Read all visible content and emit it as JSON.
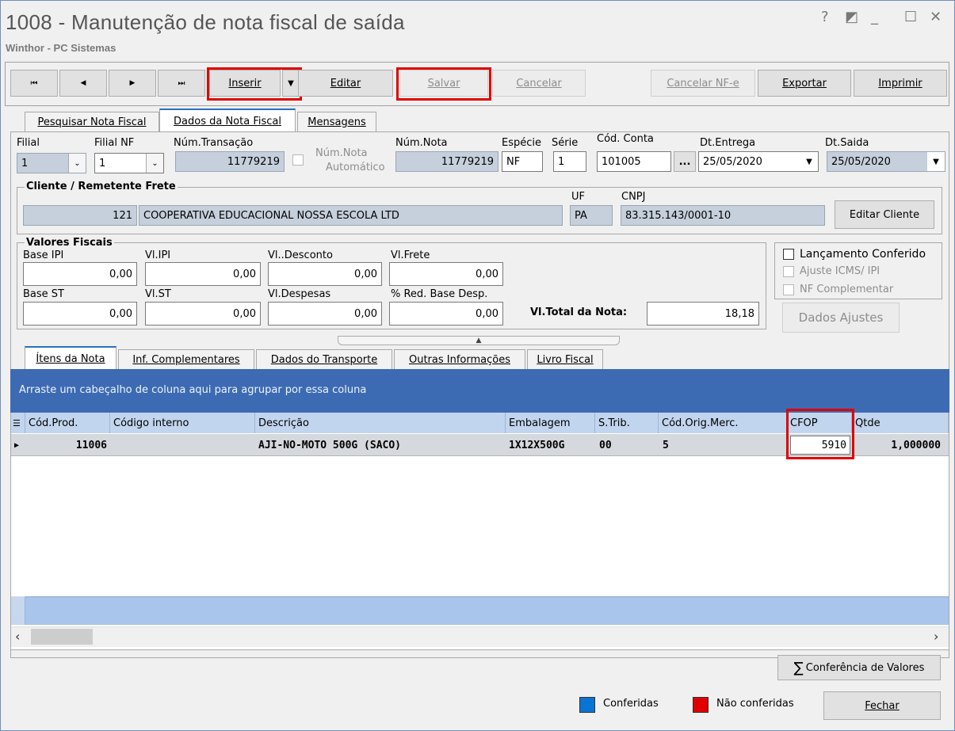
{
  "window": {
    "title": "1008 - Manutenção de nota fiscal de saída",
    "subtitle": "Winthor - PC Sistemas",
    "controls": [
      "?",
      "◩",
      "_",
      "☐",
      "✕"
    ]
  },
  "toolbar": {
    "first": "⏮",
    "prev": "◀",
    "next": "▶",
    "last": "⏭",
    "inserir": "Inserir",
    "editar": "Editar",
    "salvar": "Salvar",
    "cancelar": "Cancelar",
    "cancelar_nfe": "Cancelar NF-e",
    "exportar": "Exportar",
    "imprimir": "Imprimir"
  },
  "tabs": [
    "Pesquisar Nota Fiscal",
    "Dados da Nota Fiscal",
    "Mensagens"
  ],
  "form": {
    "filial_label": "Filial",
    "filial_value": "1",
    "filial_nf_label": "Filial NF",
    "filial_nf_value": "1",
    "num_transacao_label": "Núm.Transação",
    "num_transacao_value": "11779219",
    "num_nota_auto_label1": "Núm.Nota",
    "num_nota_auto_label2": "Automático",
    "num_nota_label": "Núm.Nota",
    "num_nota_value": "11779219",
    "especie_label": "Espécie",
    "especie_value": "NF",
    "serie_label": "Série",
    "serie_value": "1",
    "cod_conta_label": "Cód. Conta",
    "cod_conta_value": "101005",
    "cod_conta_btn": "...",
    "dt_entrega_label": "Dt.Entrega",
    "dt_entrega_value": "25/05/2020",
    "dt_saida_label": "Dt.Saida",
    "dt_saida_value": "25/05/2020"
  },
  "cliente": {
    "section_label": "Cliente / Remetente Frete",
    "code": "121",
    "name": "COOPERATIVA EDUCACIONAL NOSSA ESCOLA LTD",
    "uf_label": "UF",
    "uf_value": "PA",
    "cnpj_label": "CNPJ",
    "cnpj_value": "83.315.143/0001-10",
    "edit_button": "Editar Cliente"
  },
  "valores": {
    "section_label": "Valores Fiscais",
    "base_ipi_label": "Base IPI",
    "base_ipi": "0,00",
    "vl_ipi_label": "Vl.IPI",
    "vl_ipi": "0,00",
    "vl_desconto_label": "Vl..Desconto",
    "vl_desconto": "0,00",
    "vl_frete_label": "Vl.Frete",
    "vl_frete": "0,00",
    "base_st_label": "Base ST",
    "base_st": "0,00",
    "vl_st_label": "Vl.ST",
    "vl_st": "0,00",
    "vl_despesas_label": "Vl.Despesas",
    "vl_despesas": "0,00",
    "red_base_label": "% Red. Base Desp.",
    "red_base": "0,00",
    "total_label": "Vl.Total da Nota:",
    "total": "18,18"
  },
  "options": {
    "lancamento": "Lançamento Conferido",
    "ajuste": "Ajuste ICMS/ IPI",
    "nf_compl": "NF Complementar",
    "dados_ajustes": "Dados Ajustes"
  },
  "subtabs": [
    "Ítens da Nota",
    "Inf. Complementares",
    "Dados do Transporte",
    "Outras Informações",
    "Livro Fiscal"
  ],
  "grid": {
    "group_hint": "Arraste um cabeçalho de coluna aqui para agrupar por essa coluna",
    "columns": [
      "Cód.Prod.",
      "Código interno",
      "Descrição",
      "Embalagem",
      "S.Trib.",
      "Cód.Orig.Merc.",
      "CFOP",
      "Qtde"
    ],
    "rows": [
      {
        "cod_prod": "11006",
        "codigo_interno": "",
        "descricao": "AJI-NO-MOTO 500G (SACO)",
        "embalagem": "1X12X500G",
        "s_trib": "00",
        "cod_orig": "5",
        "cfop": "5910",
        "qtde": "1,000000"
      }
    ]
  },
  "footer": {
    "conferencia": "Conferência de Valores",
    "legend_conferidas": "Conferidas",
    "legend_nao": "Não conferidas",
    "fechar": "Fechar",
    "color_conferidas": "#0a74d4",
    "color_nao": "#e00000"
  }
}
